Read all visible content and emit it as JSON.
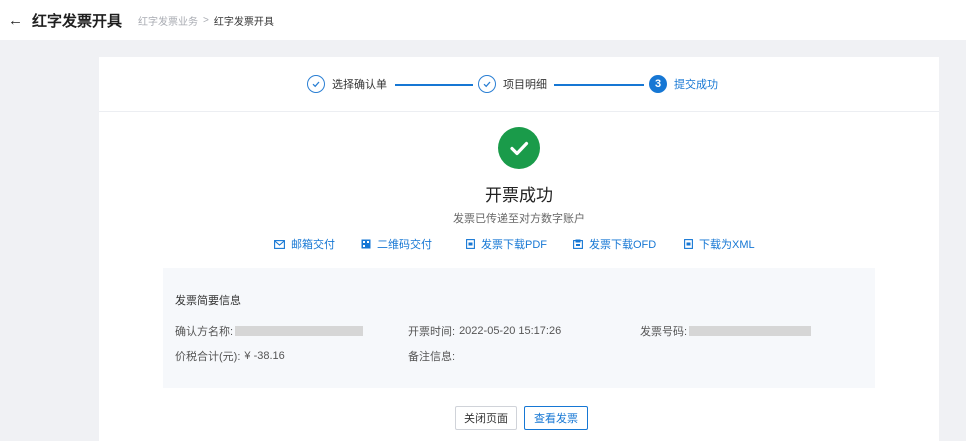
{
  "header": {
    "title": "红字发票开具",
    "breadcrumb": {
      "parent": "红字发票业务",
      "separator": ">",
      "current": "红字发票开具"
    }
  },
  "steps": [
    {
      "label": "选择确认单",
      "state": "done"
    },
    {
      "label": "项目明细",
      "state": "done"
    },
    {
      "number": "3",
      "label": "提交成功",
      "state": "active"
    }
  ],
  "result": {
    "title": "开票成功",
    "subtitle": "发票已传递至对方数字账户"
  },
  "delivery": {
    "email": "邮箱交付",
    "qrcode": "二维码交付",
    "pdf": "发票下载PDF",
    "ofd": "发票下载OFD",
    "xml": "下载为XML"
  },
  "summary": {
    "title": "发票简要信息",
    "buyer_label": "确认方名称:",
    "issue_time_label": "开票时间:",
    "issue_time_value": "2022-05-20 15:17:26",
    "invoice_no_label": "发票号码:",
    "total_label": "价税合计(元):",
    "total_value": "¥ -38.16",
    "remark_label": "备注信息:"
  },
  "buttons": {
    "close": "关闭页面",
    "view": "查看发票"
  },
  "colors": {
    "accent": "#1677d4",
    "success": "#1a9b4a",
    "page_bg": "#f0f1f4"
  }
}
